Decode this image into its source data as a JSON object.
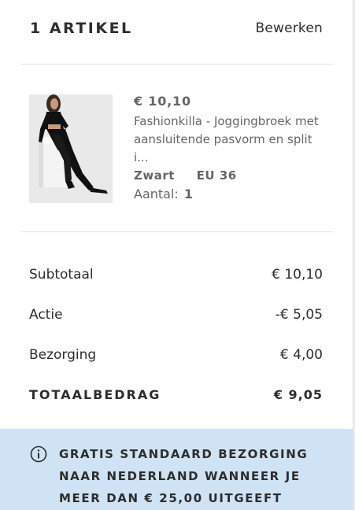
{
  "cart": {
    "title": "1 ARTIKEL",
    "edit_label": "Bewerken"
  },
  "item": {
    "price": "€ 10,10",
    "name_line1": "Fashionkilla - Joggingbroek met",
    "name_line2": "aansluitende pasvorm en split i...",
    "color": "Zwart",
    "size": "EU 36",
    "quantity_label": "Aantal:",
    "quantity": "1"
  },
  "summary": {
    "subtotal_label": "Subtotaal",
    "subtotal_value": "€ 10,10",
    "discount_label": "Actie",
    "discount_value": "-€ 5,05",
    "shipping_label": "Bezorging",
    "shipping_value": "€ 4,00",
    "total_label": "TOTAALBEDRAG",
    "total_value": "€ 9,05"
  },
  "banner": {
    "line1": "GRATIS STANDAARD BEZORGING",
    "line2": "NAAR NEDERLAND WANNEER JE",
    "line3": "MEER DAN € 25,00 UITGEEFT",
    "icon": "info-icon",
    "background": "#cfe3f4"
  }
}
